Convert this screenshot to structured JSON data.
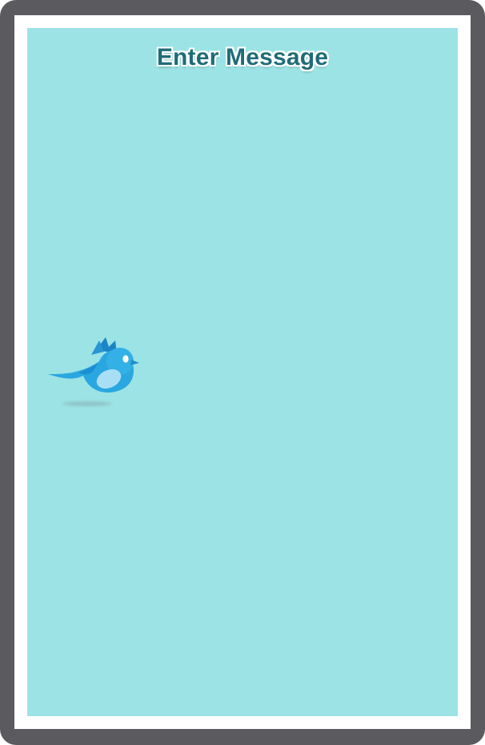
{
  "screen": {
    "title": "Enter Message"
  },
  "icons": {
    "bird": "twitter-bird-icon"
  },
  "colors": {
    "frame": "#5a5a5f",
    "inner_border": "#ffffff",
    "screen_background": "#9ce3e6",
    "title_text": "#1f6c79",
    "bird_body": "#2aa7e0",
    "bird_belly": "#a9dff4"
  }
}
